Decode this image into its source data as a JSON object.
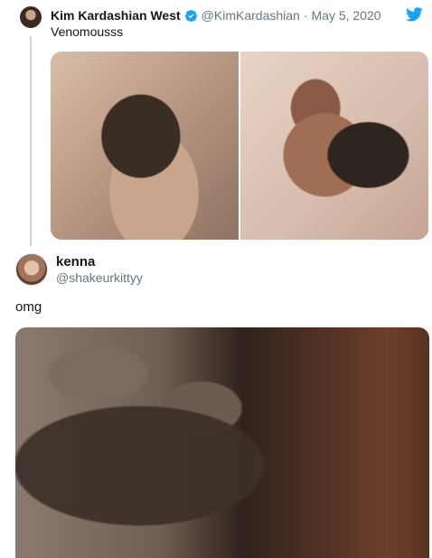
{
  "quoted_tweet": {
    "author_name": "Kim Kardashian West",
    "verified_icon": "verified-badge-icon",
    "handle": "@KimKardashian",
    "separator": "·",
    "date": "May 5, 2020",
    "text": "Venomousss",
    "brand_icon": "twitter-bird-icon",
    "accent_color": "#1da1f2"
  },
  "reply": {
    "author_name": "kenna",
    "handle": "@shakeurkittyy",
    "text": "omg"
  }
}
